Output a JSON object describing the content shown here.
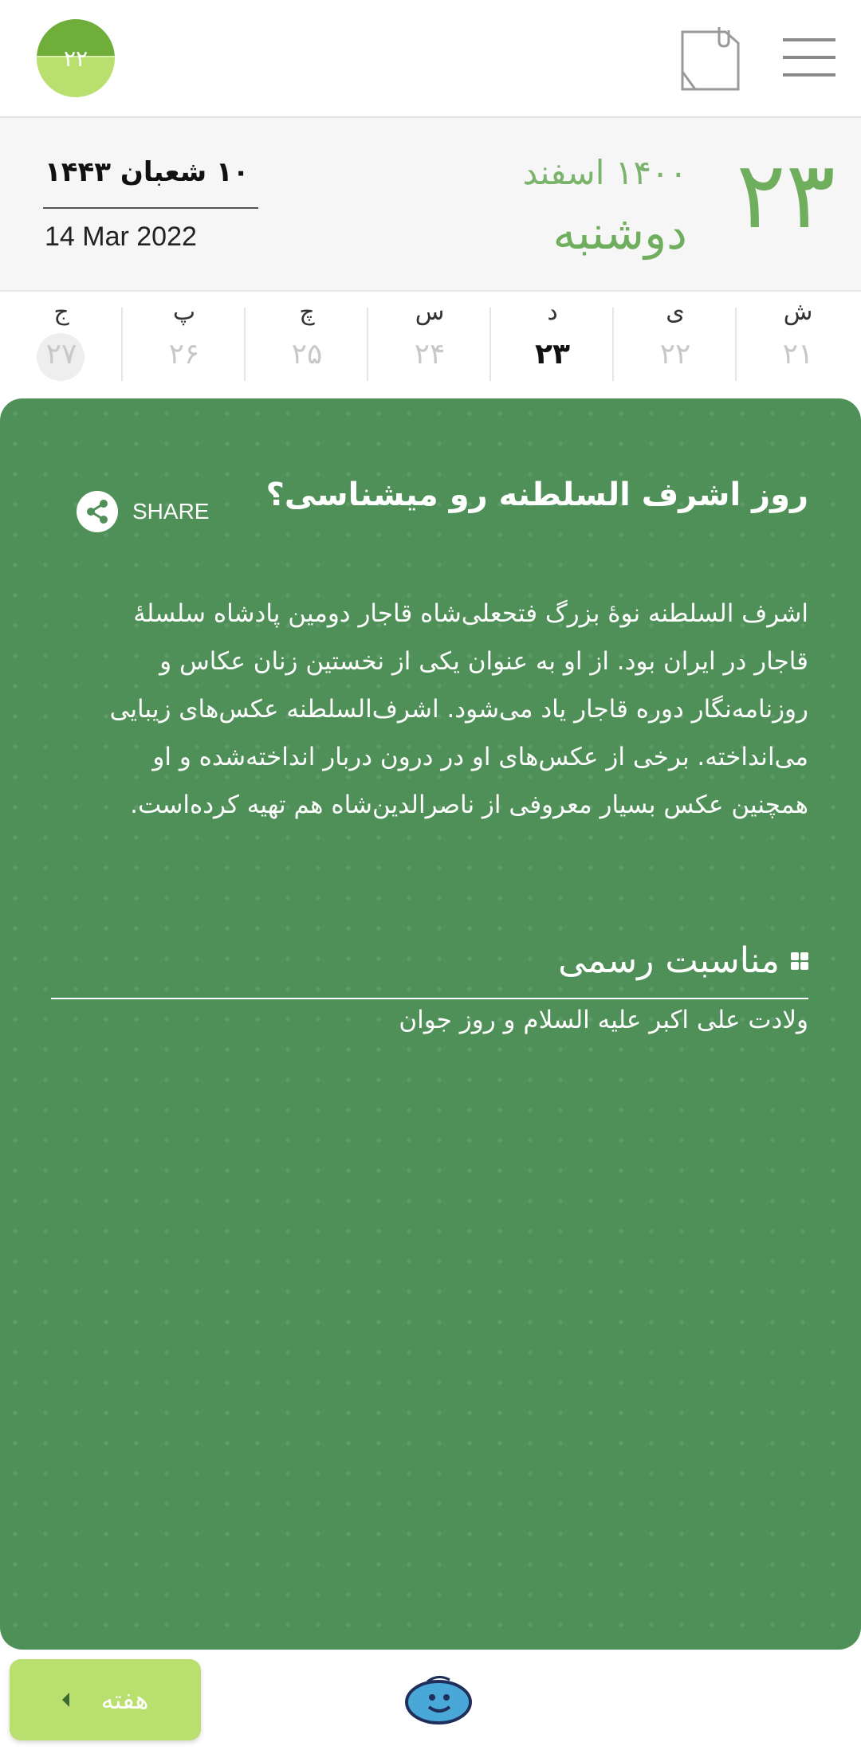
{
  "header": {
    "badge_number": "۲۲",
    "note_icon": "note-icon",
    "menu_icon": "hamburger-menu-icon"
  },
  "date": {
    "day_big": "۲۳",
    "month_year": "۱۴۰۰ اسفند",
    "weekday_name": "دوشنبه",
    "hijri": "۱۰ شعبان ۱۴۴۳",
    "gregorian": "14 Mar 2022"
  },
  "week": [
    {
      "letter": "ش",
      "num": "۲۱"
    },
    {
      "letter": "ی",
      "num": "۲۲"
    },
    {
      "letter": "د",
      "num": "۲۳"
    },
    {
      "letter": "س",
      "num": "۲۴"
    },
    {
      "letter": "چ",
      "num": "۲۵"
    },
    {
      "letter": "پ",
      "num": "۲۶"
    },
    {
      "letter": "ج",
      "num": "۲۷"
    }
  ],
  "card": {
    "title": "روز اشرف السلطنه رو میشناسی؟",
    "share_label": "SHARE",
    "body": "اشرف السلطنه نوهٔ بزرگ فتحعلی‌شاه قاجار دومین پادشاه سلسلهٔ قاجار در ایران بود. از او به عنوان یکی از نخستین زنان عکاس و روزنامه‌نگار دوره قاجار یاد می‌شود. اشرف‌السلطنه عکس‌های زیبایی می‌انداخته. برخی از عکس‌های او در درون دربار انداخته‌شده و او همچنین عکس بسیار معروفی از ناصرالدین‌شاه هم تهیه کرده‌است.",
    "section_title": "مناسبت رسمی",
    "event": "ولادت علی اکبر علیه السلام و روز جوان"
  },
  "bottom": {
    "week_button": "هفته"
  },
  "colors": {
    "accent": "#6fae5c",
    "card": "#4f8f58",
    "button": "#b9df6e"
  }
}
